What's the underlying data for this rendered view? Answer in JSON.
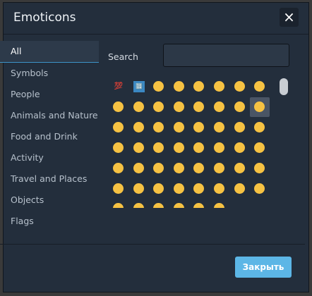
{
  "dialog": {
    "title": "Emoticons",
    "close_icon": "×",
    "close_button_label": "Закрыть"
  },
  "sidebar": {
    "items": [
      {
        "label": "All",
        "active": true
      },
      {
        "label": "Symbols"
      },
      {
        "label": "People"
      },
      {
        "label": "Animals and Nature"
      },
      {
        "label": "Food and Drink"
      },
      {
        "label": "Activity"
      },
      {
        "label": "Travel and Places"
      },
      {
        "label": "Objects"
      },
      {
        "label": "Flags"
      }
    ]
  },
  "search": {
    "label": "Search",
    "value": ""
  },
  "emoji_grid": {
    "selected_index": 15,
    "items": [
      {
        "name": "hundred-points-icon",
        "text": "💯",
        "text_color": "#e0245e"
      },
      {
        "name": "input-numbers-icon",
        "text": "🔢",
        "bg": "#3b88c3",
        "text_color": "#ffffff"
      },
      {
        "name": "grinning-face-icon"
      },
      {
        "name": "grinning-face-big-eyes-icon"
      },
      {
        "name": "grinning-squinting-face-icon"
      },
      {
        "name": "beaming-face-icon"
      },
      {
        "name": "rolling-laughing-icon"
      },
      {
        "name": "face-with-tears-of-joy-icon"
      },
      {
        "name": "smiley-icon"
      },
      {
        "name": "laughing-face-icon"
      },
      {
        "name": "sweat-smile-icon"
      },
      {
        "name": "grinning-squint-icon"
      },
      {
        "name": "halo-face-icon"
      },
      {
        "name": "winking-face-icon"
      },
      {
        "name": "blushing-face-icon"
      },
      {
        "name": "slightly-smiling-face-icon"
      },
      {
        "name": "upside-down-face-icon"
      },
      {
        "name": "relieved-face-icon"
      },
      {
        "name": "savoring-face-icon"
      },
      {
        "name": "relaxed-face-icon"
      },
      {
        "name": "heart-eyes-icon"
      },
      {
        "name": "face-blowing-kiss-icon"
      },
      {
        "name": "kissing-face-icon"
      },
      {
        "name": "kissing-smiling-icon"
      },
      {
        "name": "kissing-closed-eyes-icon"
      },
      {
        "name": "tongue-out-icon"
      },
      {
        "name": "winking-tongue-icon"
      },
      {
        "name": "zany-face-icon"
      },
      {
        "name": "squinting-tongue-icon"
      },
      {
        "name": "monocle-face-icon"
      },
      {
        "name": "nerd-face-icon"
      },
      {
        "name": "sunglasses-face-icon"
      },
      {
        "name": "money-mouth-icon"
      },
      {
        "name": "star-struck-icon"
      },
      {
        "name": "clown-face-icon"
      },
      {
        "name": "cowboy-face-icon"
      },
      {
        "name": "hugging-face-icon"
      },
      {
        "name": "smirking-face-icon"
      },
      {
        "name": "neutral-face-icon"
      },
      {
        "name": "expressionless-face-icon"
      },
      {
        "name": "unamused-face-icon"
      },
      {
        "name": "rolling-eyes-icon"
      },
      {
        "name": "thinking-face-icon"
      },
      {
        "name": "lying-face-icon"
      },
      {
        "name": "shushing-face-icon"
      },
      {
        "name": "hand-over-mouth-icon"
      },
      {
        "name": "flushed-face-icon"
      },
      {
        "name": "frowning-face-icon"
      },
      {
        "name": "pensive-face-icon"
      },
      {
        "name": "confused-face-icon"
      },
      {
        "name": "sleepy-face-icon"
      },
      {
        "name": "grimacing-face-icon"
      },
      {
        "name": "angry-face-icon"
      },
      {
        "name": "pouting-face-icon"
      }
    ]
  },
  "colors": {
    "accent": "#5cb6e6",
    "dialog_bg": "#232e3c",
    "face": "#f6c243"
  }
}
